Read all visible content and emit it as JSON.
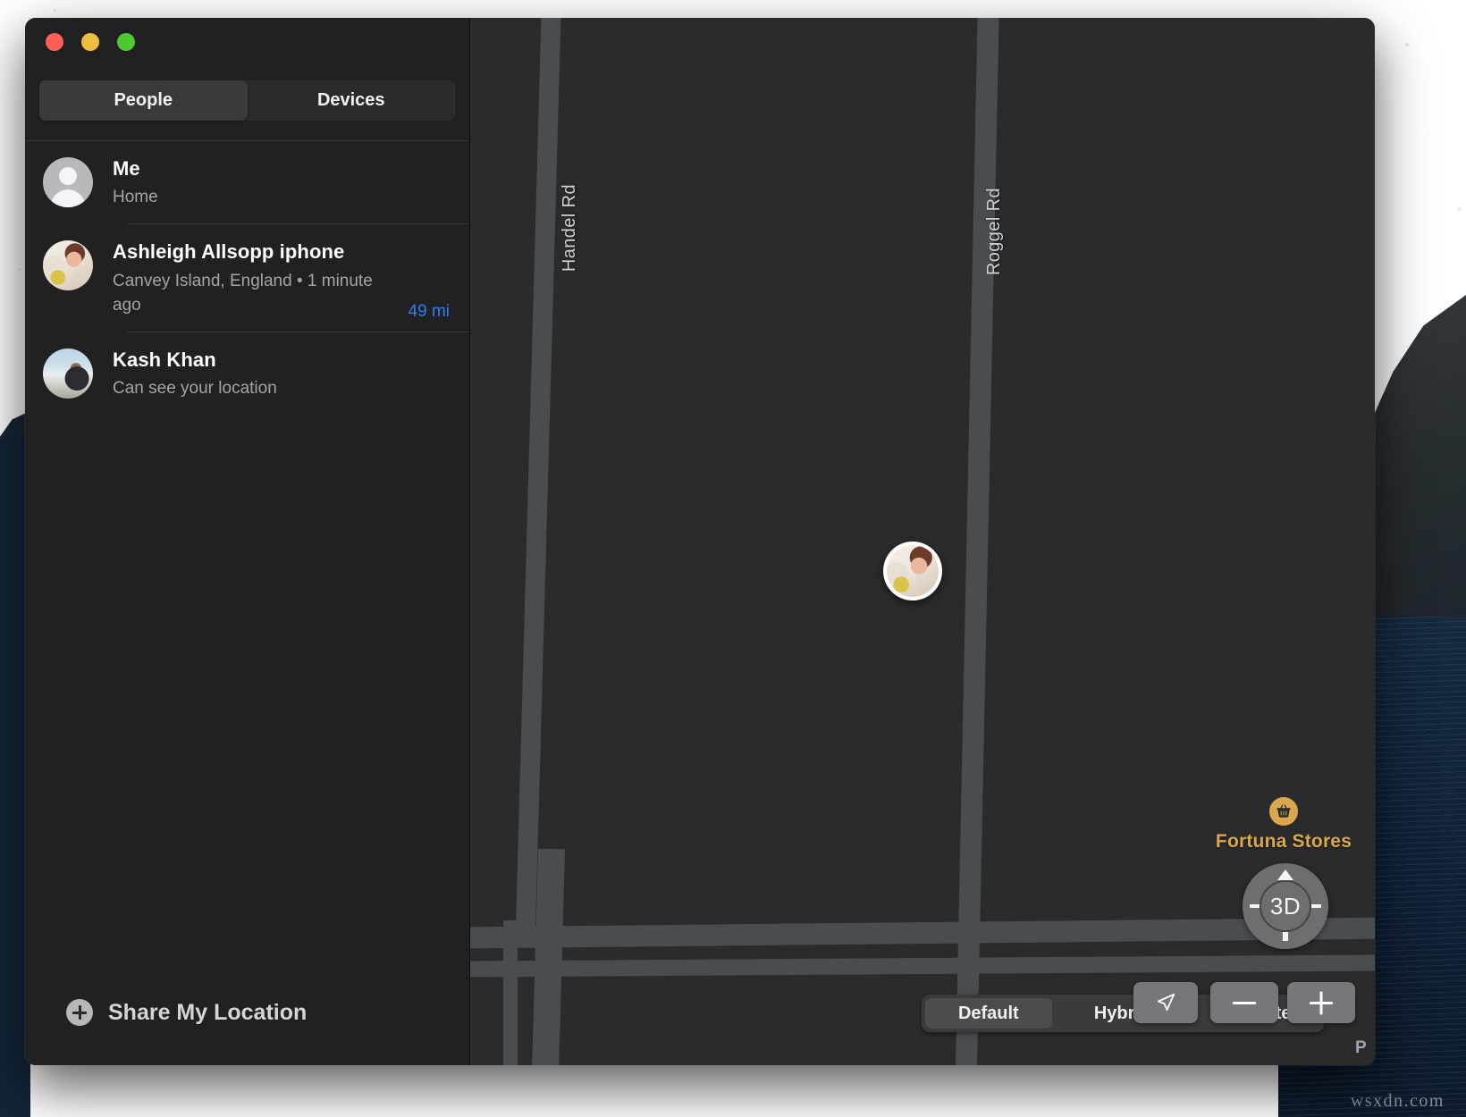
{
  "window": {
    "traffic_lights": [
      {
        "name": "close",
        "color": "#ff5f57"
      },
      {
        "name": "minimize",
        "color": "#f0bd3f"
      },
      {
        "name": "zoom",
        "color": "#4fc832"
      }
    ]
  },
  "sidebar": {
    "segmented": {
      "tabs": [
        {
          "label": "People",
          "active": true
        },
        {
          "label": "Devices",
          "active": false
        }
      ]
    },
    "people": [
      {
        "name": "Me",
        "subtitle": "Home",
        "distance": "",
        "avatar": "generic-person-avatar"
      },
      {
        "name": "Ashleigh Allsopp iphone",
        "subtitle": "Canvey Island, England • 1 minute ago",
        "distance": "49 mi",
        "avatar": "ashleigh-photo-avatar"
      },
      {
        "name": "Kash Khan",
        "subtitle": "Can see your location",
        "distance": "",
        "avatar": "kash-photo-avatar"
      }
    ],
    "share_button": {
      "label": "Share My Location",
      "icon": "plus-circle-icon"
    }
  },
  "map": {
    "roads": [
      {
        "label": "Handel Rd"
      },
      {
        "label": "Roggel Rd"
      }
    ],
    "pin": {
      "name": "ashleigh-location-pin"
    },
    "poi": {
      "label": "Fortuna Stores",
      "icon": "shopping-basket-icon",
      "color": "#d9a84e"
    },
    "map_type": {
      "options": [
        {
          "label": "Default",
          "active": true
        },
        {
          "label": "Hybrid",
          "active": false
        },
        {
          "label": "Satellite",
          "active": false
        }
      ]
    },
    "controls": {
      "dial_label": "3D",
      "locate_icon": "navigation-arrow-icon",
      "zoom_out_icon": "minus-icon",
      "zoom_in_icon": "plus-icon"
    },
    "attribution": "P"
  },
  "desktop": {
    "watermark": "wsxdn.com"
  },
  "colors": {
    "accent_blue": "#2d7ff0",
    "poi_gold": "#d9a84e",
    "window_bg": "#1e1e1e",
    "sidebar_bg": "#212121",
    "map_bg": "#2b2b2b"
  }
}
